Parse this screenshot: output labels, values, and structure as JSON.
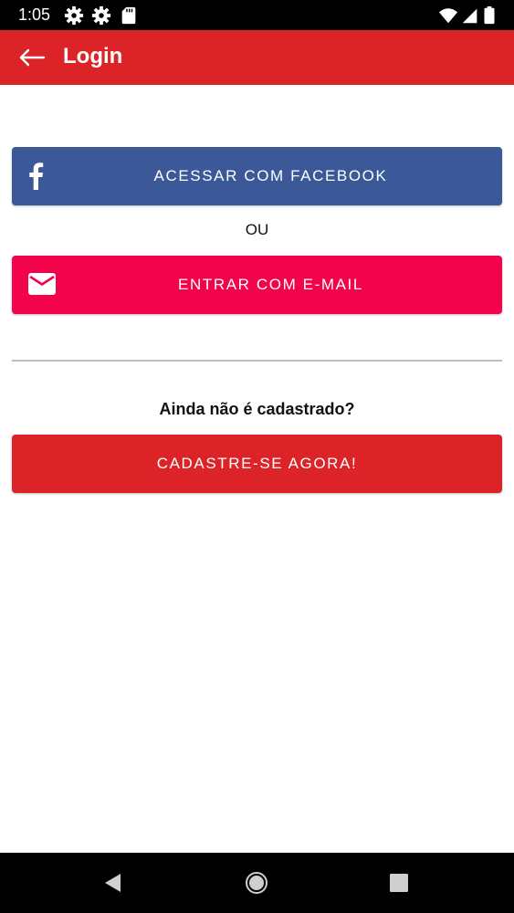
{
  "status_bar": {
    "time": "1:05",
    "icons": [
      "settings-icon",
      "settings-icon",
      "sd-card-icon",
      "wifi-icon",
      "cellular-signal-icon",
      "battery-icon"
    ]
  },
  "app_bar": {
    "title": "Login",
    "back_icon": "arrow-left-icon",
    "color": "#dc2428"
  },
  "main": {
    "facebook_button": {
      "label": "ACESSAR COM FACEBOOK",
      "icon": "facebook-icon",
      "color": "#3b5998"
    },
    "separator_text": "OU",
    "email_button": {
      "label": "ENTRAR COM E-MAIL",
      "icon": "mail-icon",
      "color": "#f2034c"
    },
    "signup_prompt": "Ainda não é cadastrado?",
    "signup_button": {
      "label": "CADASTRE-SE AGORA!",
      "color": "#dc2428"
    }
  },
  "nav_bar": {
    "icons": [
      "back-triangle-icon",
      "home-circle-icon",
      "recents-square-icon"
    ]
  }
}
